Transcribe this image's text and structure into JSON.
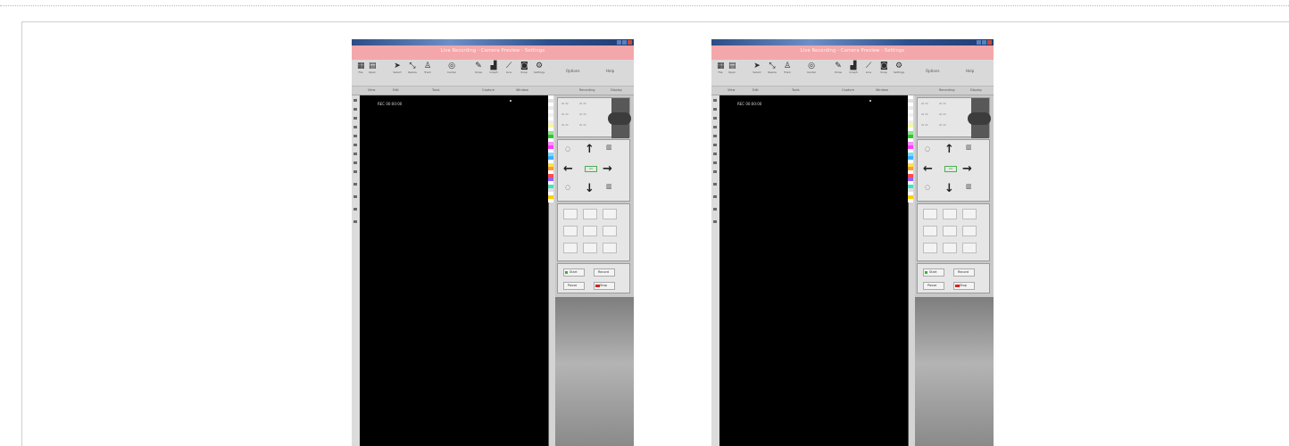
{
  "colors": {
    "page_background": "#ffffff",
    "title_bar": "#f4a7aa",
    "canvas": "#000000",
    "panel": "#c8c8c8",
    "ok_green": "#4caf50",
    "stop_red": "#d42323"
  },
  "windows": [
    {
      "title": "Live Recording - Camera Preview - Settings",
      "toolbar": [
        {
          "icon": "grid-icon",
          "label": "File"
        },
        {
          "icon": "folder-icon",
          "label": "Open"
        },
        {
          "icon": "cursor-icon",
          "label": "Select"
        },
        {
          "icon": "resize-icon",
          "label": "Resize"
        },
        {
          "icon": "person-icon",
          "label": "Track"
        },
        {
          "icon": "target-icon",
          "label": "Center"
        },
        {
          "icon": "pen-icon",
          "label": "Draw"
        },
        {
          "icon": "chart-icon",
          "label": "Graph"
        },
        {
          "icon": "line-icon",
          "label": "Line"
        },
        {
          "icon": "camera-icon",
          "label": "Snap"
        },
        {
          "icon": "gear-icon",
          "label": "Settings"
        }
      ],
      "toolbar_right": [
        "Options",
        "Help"
      ],
      "menu": [
        "View",
        "Edit",
        "Tools",
        "Capture",
        "Window",
        "Recording",
        "Display"
      ],
      "canvas_caption": "REC 00:00:00",
      "controls": {
        "ok_label": "OK",
        "start_label": "Start",
        "stop_label": "Stop",
        "record_label": "Record",
        "pause_label": "Pause"
      }
    },
    {
      "title": "Live Recording - Camera Preview - Settings",
      "toolbar": [
        {
          "icon": "grid-icon",
          "label": "File"
        },
        {
          "icon": "folder-icon",
          "label": "Open"
        },
        {
          "icon": "cursor-icon",
          "label": "Select"
        },
        {
          "icon": "resize-icon",
          "label": "Resize"
        },
        {
          "icon": "person-icon",
          "label": "Track"
        },
        {
          "icon": "target-icon",
          "label": "Center"
        },
        {
          "icon": "pen-icon",
          "label": "Draw"
        },
        {
          "icon": "chart-icon",
          "label": "Graph"
        },
        {
          "icon": "line-icon",
          "label": "Line"
        },
        {
          "icon": "camera-icon",
          "label": "Snap"
        },
        {
          "icon": "gear-icon",
          "label": "Settings"
        }
      ],
      "toolbar_right": [
        "Options",
        "Help"
      ],
      "menu": [
        "View",
        "Edit",
        "Tools",
        "Capture",
        "Window",
        "Recording",
        "Display"
      ],
      "canvas_caption": "REC 00:00:00",
      "controls": {
        "ok_label": "OK",
        "start_label": "Start",
        "stop_label": "Stop",
        "record_label": "Record",
        "pause_label": "Pause"
      }
    }
  ]
}
